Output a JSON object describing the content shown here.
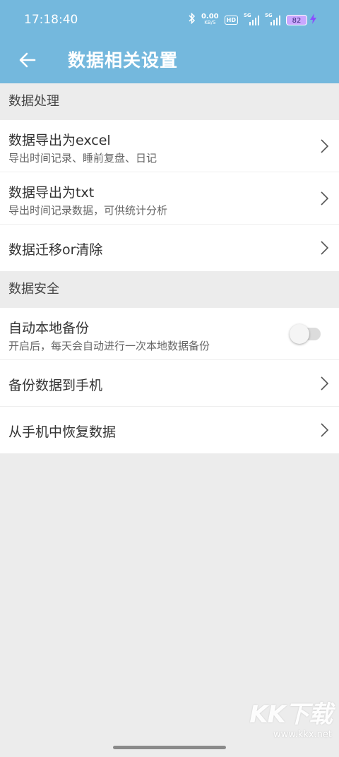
{
  "status_bar": {
    "time": "17:18:40",
    "bluetooth_icon": "bluetooth-icon",
    "net_speed_value": "0.00",
    "net_speed_unit": "KB/S",
    "hd_badge": "HD",
    "signal1_tag": "5G",
    "signal2_tag": "5G",
    "battery_level": "82",
    "charging_icon": "bolt-icon"
  },
  "app_bar": {
    "back_icon": "arrow-left-icon",
    "title": "数据相关设置"
  },
  "sections": [
    {
      "header": "数据处理",
      "items": [
        {
          "title": "数据导出为excel",
          "subtitle": "导出时间记录、睡前复盘、日记",
          "control": "chevron"
        },
        {
          "title": "数据导出为txt",
          "subtitle": "导出时间记录数据，可供统计分析",
          "control": "chevron"
        },
        {
          "title": "数据迁移or清除",
          "control": "chevron"
        }
      ]
    },
    {
      "header": "数据安全",
      "items": [
        {
          "title": "自动本地备份",
          "subtitle": "开启后，每天会自动进行一次本地数据备份",
          "control": "toggle",
          "toggle_on": false
        },
        {
          "title": "备份数据到手机",
          "control": "chevron"
        },
        {
          "title": "从手机中恢复数据",
          "control": "chevron"
        }
      ]
    }
  ],
  "watermark": {
    "logo": "KK下载",
    "url": "www.kkx.net"
  },
  "colors": {
    "primary": "#74b8dd",
    "background": "#ececec",
    "card": "#ffffff"
  }
}
